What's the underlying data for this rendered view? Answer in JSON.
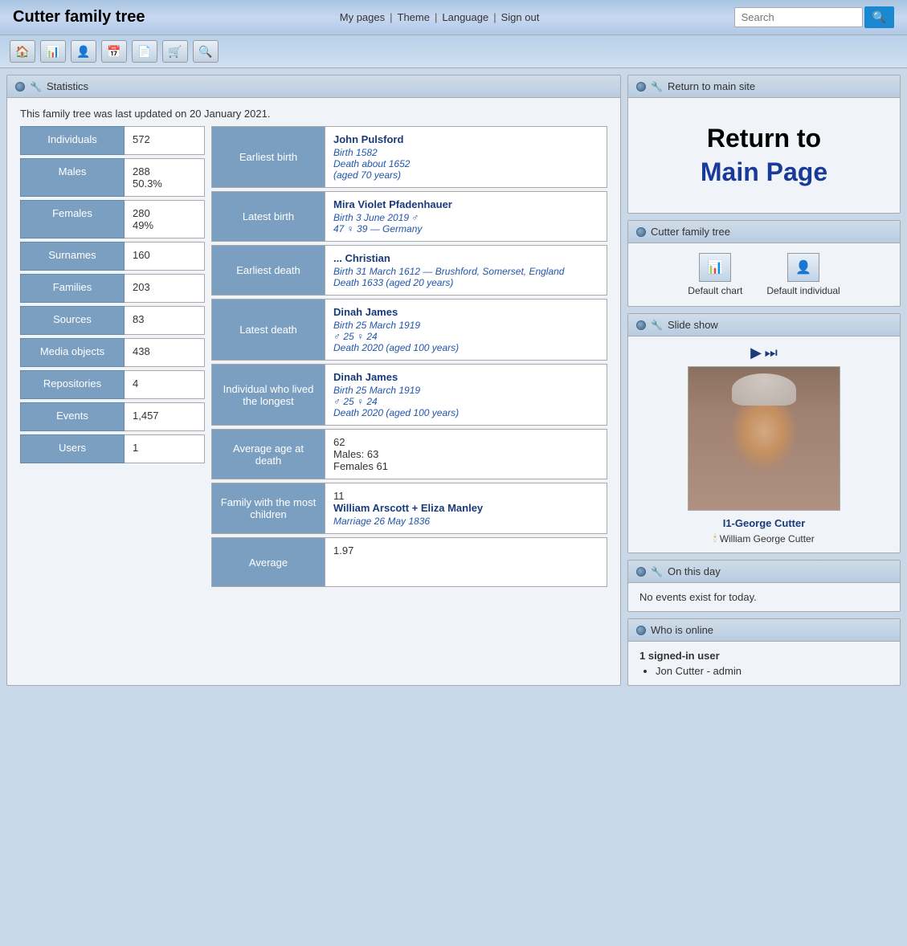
{
  "site": {
    "title": "Cutter family tree",
    "nav": {
      "my_pages": "My pages",
      "theme": "Theme",
      "language": "Language",
      "sign_out": "Sign out"
    },
    "search": {
      "placeholder": "Search",
      "button_label": "🔍"
    }
  },
  "toolbar": {
    "buttons": [
      {
        "icon": "🏠",
        "name": "home"
      },
      {
        "icon": "📊",
        "name": "chart"
      },
      {
        "icon": "👤",
        "name": "individual"
      },
      {
        "icon": "📅",
        "name": "calendar"
      },
      {
        "icon": "📄",
        "name": "reports"
      },
      {
        "icon": "🛒",
        "name": "cart"
      },
      {
        "icon": "🔍",
        "name": "search"
      }
    ]
  },
  "left_panel": {
    "title": "Statistics",
    "update_text": "This family tree was last updated on 20 January 2021.",
    "stats": [
      {
        "label": "Individuals",
        "value": "572"
      },
      {
        "label": "Males",
        "value": "288\n50.3%"
      },
      {
        "label": "Females",
        "value": "280\n49%"
      },
      {
        "label": "Surnames",
        "value": "160"
      },
      {
        "label": "Families",
        "value": "203"
      },
      {
        "label": "Sources",
        "value": "83"
      },
      {
        "label": "Media objects",
        "value": "438"
      },
      {
        "label": "Repositories",
        "value": "4"
      },
      {
        "label": "Events",
        "value": "1,457"
      },
      {
        "label": "Users",
        "value": "1"
      }
    ],
    "categories": [
      {
        "label": "Earliest birth",
        "name": "John Pulsford",
        "detail": "Birth 1582\nDeath about 1652\n(aged 70 years)"
      },
      {
        "label": "Latest birth",
        "name": "Mira Violet Pfadenhauer",
        "detail": "Birth 3 June 2019 ♂\n47 ♀ 39 — Germany"
      },
      {
        "label": "Earliest death",
        "name": "... Christian",
        "detail": "Birth 31 March 1612 — Brushford, Somerset, England\nDeath 1633 (aged 20 years)"
      },
      {
        "label": "Latest death",
        "name": "Dinah James",
        "detail": "Birth 25 March 1919\n♂ 25 ♀ 24\nDeath 2020 (aged 100 years)"
      },
      {
        "label": "Individual who lived the longest",
        "name": "Dinah James",
        "detail": "Birth 25 March 1919\n♂ 25 ♀ 24\nDeath 2020 (aged 100 years)"
      },
      {
        "label": "Average age at death",
        "plain": "62\nMales: 63\nFemales 61",
        "name": "",
        "detail": ""
      },
      {
        "label": "Family with the most children",
        "plain": "11",
        "name": "William Arscott + Eliza Manley",
        "detail": "Marriage 26 May 1836"
      },
      {
        "label": "Average",
        "plain": "1.97",
        "name": "",
        "detail": ""
      }
    ]
  },
  "right_panel": {
    "return_section": {
      "title": "Return to main site",
      "return_line1": "Return to",
      "return_line2": "Main Page"
    },
    "family_tree_section": {
      "title": "Cutter family tree",
      "default_chart": "Default chart",
      "default_individual": "Default individual"
    },
    "slideshow": {
      "title": "Slide show",
      "caption": "I1-George Cutter",
      "link_text": "William George Cutter"
    },
    "on_this_day": {
      "title": "On this day",
      "message": "No events exist for today."
    },
    "who_online": {
      "title": "Who is online",
      "signed_in_text": "1 signed-in user",
      "users": [
        "Jon Cutter - admin"
      ]
    }
  }
}
